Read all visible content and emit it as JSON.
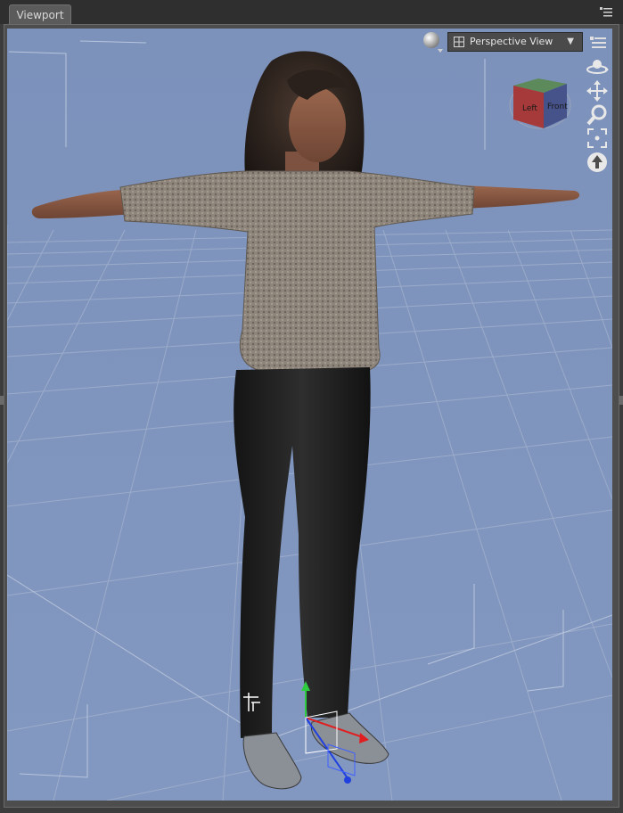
{
  "tab": {
    "label": "Viewport"
  },
  "view_selector": {
    "label": "Perspective View",
    "arrow": "▼"
  },
  "nav_cube": {
    "face_left": "Left",
    "face_front": "Front"
  },
  "colors": {
    "viewport_bg": "#7f95bd",
    "grid_line": "#a7b6d1",
    "panel_bg": "#4d4d4d",
    "tab_bg": "#5b5b5b",
    "sweater": "#8d8379",
    "pants": "#1c1c1c",
    "skin": "#8a5a44",
    "hair": "#2d2420"
  },
  "icons": {
    "render_sphere": "sphere-icon",
    "panel_menu": "panel-menu-icon",
    "orbit": "orbit-icon",
    "pan": "pan-icon",
    "zoom": "zoom-icon",
    "frame": "frame-icon",
    "reset": "reset-view-icon",
    "transform": "transform-gizmo-icon"
  }
}
